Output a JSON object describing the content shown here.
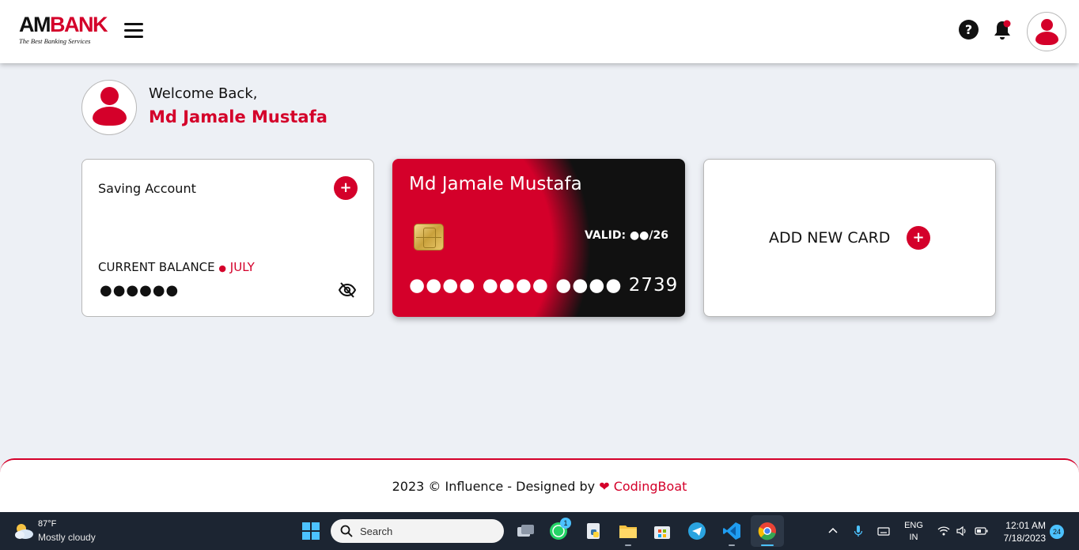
{
  "header": {
    "logo_am": "AM",
    "logo_bank": "BANK",
    "logo_tagline": "The Best Banking Services",
    "help_glyph": "?"
  },
  "welcome": {
    "greeting": "Welcome Back,",
    "name": "Md Jamale Mustafa"
  },
  "savings_card": {
    "title": "Saving Account",
    "balance_label": "CURRENT BALANCE",
    "balance_dot": "●",
    "month": "JULY",
    "masked_balance": "●●●●●●",
    "add_glyph": "+"
  },
  "credit_card": {
    "holder": "Md Jamale Mustafa",
    "valid": "VALID: ●●/26",
    "number": "●●●● ●●●● ●●●● 2739"
  },
  "add_card": {
    "label": "ADD NEW CARD",
    "add_glyph": "+"
  },
  "footer": {
    "text": "2023 © Influence - Designed by",
    "heart": "❤",
    "brand": "CodingBoat"
  },
  "taskbar": {
    "weather_temp": "87°F",
    "weather_desc": "Mostly cloudy",
    "search_placeholder": "Search",
    "whatsapp_badge": "1",
    "lang_line1": "ENG",
    "lang_line2": "IN",
    "time": "12:01 AM",
    "date": "7/18/2023",
    "notifications": "24"
  },
  "colors": {
    "brand_red": "#d4002a",
    "card_black": "#111111",
    "page_bg": "#edf0f5",
    "taskbar": "#1c2532"
  },
  "icons": [
    "hamburger-menu-icon",
    "help-icon",
    "bell-icon",
    "user-avatar-icon",
    "eye-slash-icon",
    "chip-icon",
    "windows-start-icon",
    "search-icon"
  ]
}
